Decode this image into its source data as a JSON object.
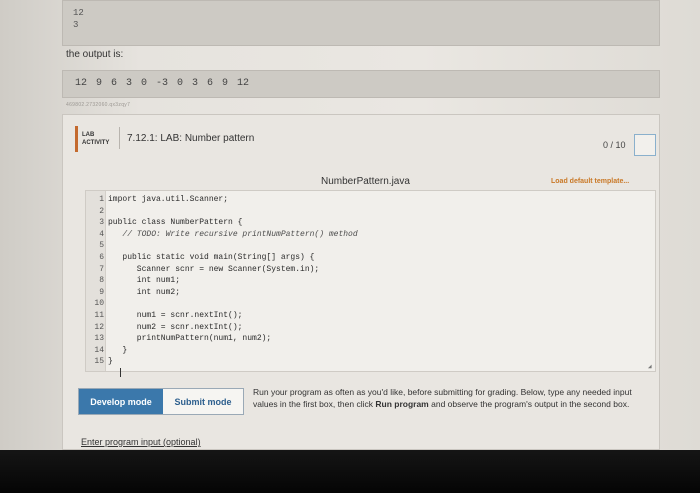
{
  "input_box": {
    "lines": [
      "12",
      "3"
    ]
  },
  "output": {
    "label": "the output is:",
    "value": "12 9 6 3 0 -3 0 3 6 9 12"
  },
  "tiny_id": "469802.2732060.qx3zqy7",
  "lab": {
    "tag_line1": "LAB",
    "tag_line2": "ACTIVITY",
    "title": "7.12.1: LAB: Number pattern",
    "score": "0 / 10",
    "file_name": "NumberPattern.java",
    "load_template": "Load default template..."
  },
  "code": {
    "lines": [
      {
        "n": "1",
        "text": "import java.util.Scanner;"
      },
      {
        "n": "2",
        "text": ""
      },
      {
        "n": "3",
        "text": "public class NumberPattern {"
      },
      {
        "n": "4",
        "text": "   // TODO: Write recursive printNumPattern() method"
      },
      {
        "n": "5",
        "text": ""
      },
      {
        "n": "6",
        "text": "   public static void main(String[] args) {"
      },
      {
        "n": "7",
        "text": "      Scanner scnr = new Scanner(System.in);"
      },
      {
        "n": "8",
        "text": "      int num1;"
      },
      {
        "n": "9",
        "text": "      int num2;"
      },
      {
        "n": "10",
        "text": ""
      },
      {
        "n": "11",
        "text": "      num1 = scnr.nextInt();"
      },
      {
        "n": "12",
        "text": "      num2 = scnr.nextInt();"
      },
      {
        "n": "13",
        "text": "      printNumPattern(num1, num2);"
      },
      {
        "n": "14",
        "text": "   }"
      },
      {
        "n": "15",
        "text": "}"
      }
    ]
  },
  "modes": {
    "develop": "Develop mode",
    "submit": "Submit mode"
  },
  "instructions": {
    "part1": "Run your program as often as you'd like, before submitting for grading. Below, type any needed input values in the first box, then click ",
    "bold": "Run program",
    "part2": " and observe the program's output in the second box."
  },
  "enter_input_label": "Enter program input (optional)"
}
